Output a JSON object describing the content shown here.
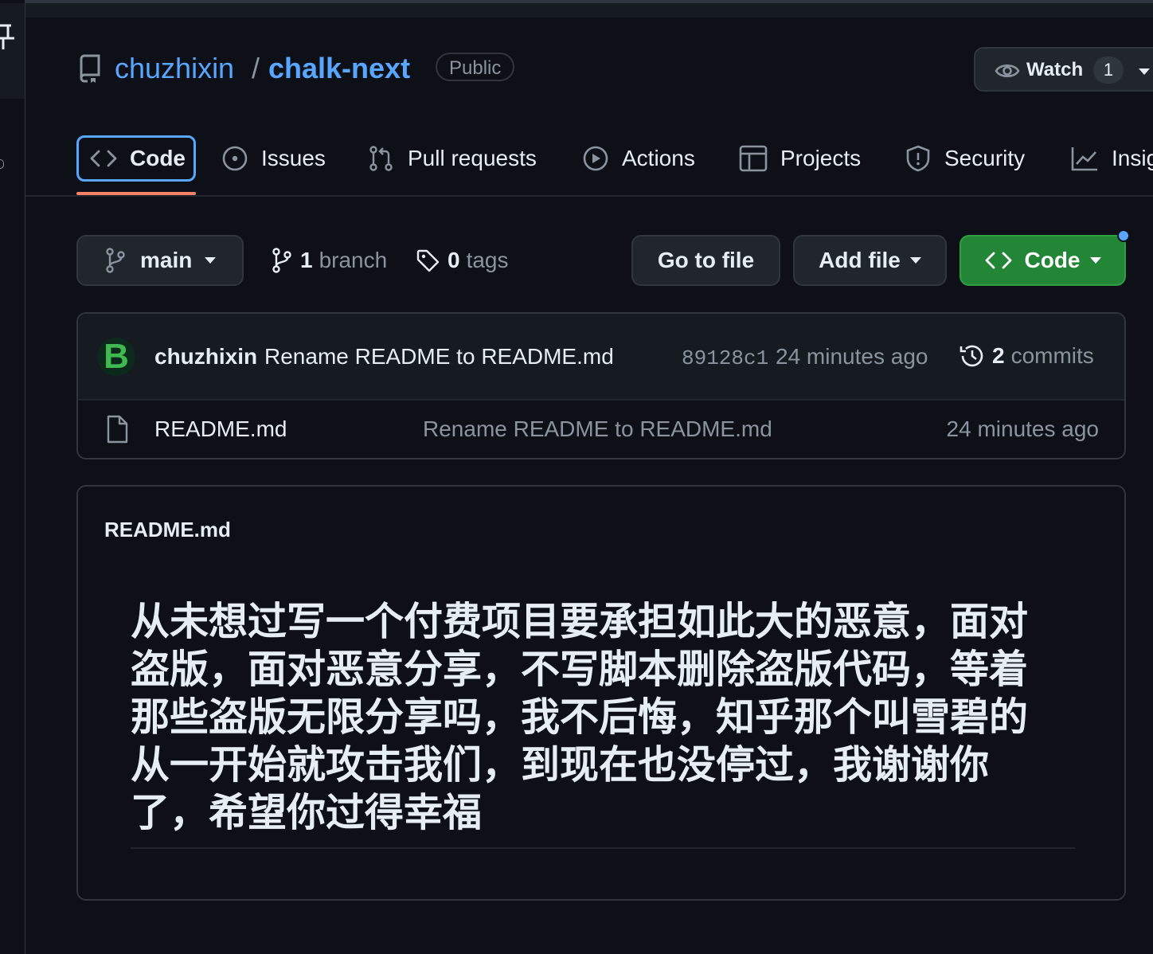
{
  "repo": {
    "owner": "chuzhixin",
    "separator": "/",
    "name": "chalk-next",
    "visibility": "Public",
    "icon": "repo-icon"
  },
  "watch": {
    "label": "Watch",
    "count": "1",
    "icon": "eye-icon"
  },
  "nav": {
    "tabs": [
      {
        "label": "Code",
        "icon": "code-icon",
        "selected": true
      },
      {
        "label": "Issues",
        "icon": "issue-opened-icon"
      },
      {
        "label": "Pull requests",
        "icon": "git-pull-request-icon"
      },
      {
        "label": "Actions",
        "icon": "play-icon"
      },
      {
        "label": "Projects",
        "icon": "table-icon"
      },
      {
        "label": "Security",
        "icon": "shield-icon"
      },
      {
        "label": "Insig",
        "icon": "graph-icon"
      }
    ]
  },
  "toolbar": {
    "branch": "main",
    "branch_count": "1",
    "branch_label": "branch",
    "tag_count": "0",
    "tag_label": "tags",
    "go_to_file": "Go to file",
    "add_file": "Add file",
    "code": "Code"
  },
  "latest_commit": {
    "avatar_letter": "B",
    "author": "chuzhixin",
    "message": "Rename README to README.md",
    "sha": "89128c1",
    "time": "24 minutes ago",
    "commit_count": "2",
    "commit_label": "commits"
  },
  "files": [
    {
      "name": "README.md",
      "message": "Rename README to README.md",
      "time": "24 minutes ago",
      "icon": "file-icon"
    }
  ],
  "readme": {
    "title": "README.md",
    "heading": "从未想过写一个付费项目要承担如此大的恶意，面对盗版，面对恶意分享，不写脚本删除盗版代码，等着那些盗版无限分享吗，我不后悔，知乎那个叫雪碧的从一开始就攻击我们，到现在也没停过，我谢谢你了，希望你过得幸福"
  },
  "colors": {
    "background": "#0d1117",
    "link": "#58a6ff",
    "muted": "#8b949e",
    "border": "#30363d",
    "primary_button": "#238636",
    "tab_underline": "#f78166"
  }
}
